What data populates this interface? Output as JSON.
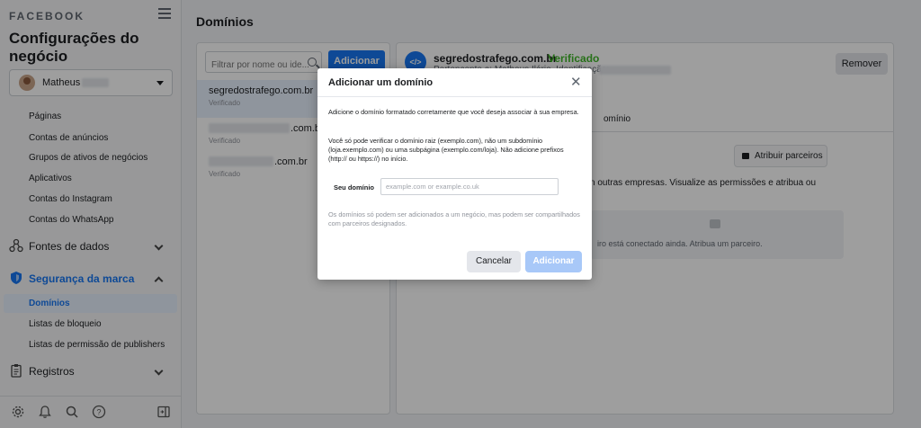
{
  "sidebar": {
    "brand": "FACEBOOK",
    "title": "Configurações do negócio",
    "account": {
      "name": "Matheus"
    },
    "pages_items": [
      "Páginas",
      "Contas de anúncios",
      "Grupos de ativos de negócios",
      "Aplicativos",
      "Contas do Instagram",
      "Contas do WhatsApp"
    ],
    "sections": {
      "data_sources": "Fontes de dados",
      "brand_safety": "Segurança da marca",
      "records": "Registros"
    },
    "brand_safety_items": [
      "Domínios",
      "Listas de bloqueio",
      "Listas de permissão de publishers"
    ]
  },
  "main": {
    "title": "Domínios",
    "filter_placeholder": "Filtrar por nome ou ide...",
    "add_button": "Adicionar",
    "domains": [
      {
        "name": "segredostrafego.com.br",
        "status": "Verificado"
      },
      {
        "name": ".com.br",
        "status": "Verificado"
      },
      {
        "name": ".com.br",
        "status": "Verificado"
      }
    ]
  },
  "detail": {
    "domain": "segredostrafego.com.br",
    "verified": "Verificado",
    "owner_text": "Pertencente a: Matheus Ilário. Identificação:",
    "remove_button": "Remover",
    "tab": "omínio",
    "partners_button": "Atribuir parceiros",
    "share_text": "n outras empresas. Visualize as permissões e atribua ou",
    "no_partner_text": "iro está conectado ainda. Atribua um parceiro."
  },
  "modal": {
    "title": "Adicionar um domínio",
    "p1": "Adicione o domínio formatado corretamente que você deseja associar à sua empresa.",
    "p2": "Você só pode verificar o domínio raiz (exemplo.com), não um subdomínio (loja.exemplo.com) ou uma subpágina (exemplo.com/loja). Não adicione prefixos (http:// ou https://) no início.",
    "domain_label": "Seu domínio",
    "domain_placeholder": "example.com or example.co.uk",
    "note": "Os domínios só podem ser adicionados a um negócio, mas podem ser compartilhados com parceiros designados.",
    "cancel": "Cancelar",
    "confirm": "Adicionar"
  },
  "colors": {
    "primary": "#1877f2",
    "verified": "#42b72a",
    "active_bg": "#e7f0fd"
  }
}
